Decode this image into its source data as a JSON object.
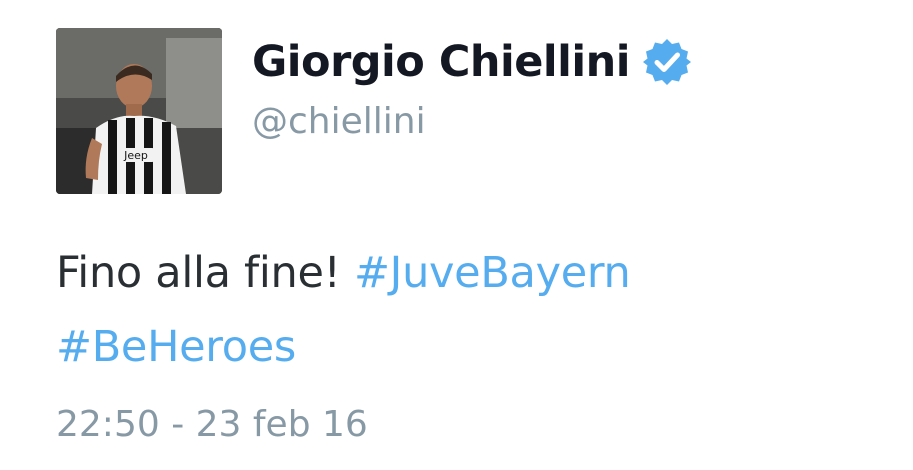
{
  "tweet": {
    "author": {
      "display_name": "Giorgio Chiellini",
      "handle": "@chiellini",
      "verified_icon": "verified-badge-icon",
      "avatar_jersey_text": "Jeep"
    },
    "text_plain": "Fino alla fine! ",
    "hashtags": [
      "#JuveBayern",
      "#BeHeroes"
    ],
    "timestamp": "22:50 - 23 feb 16"
  },
  "colors": {
    "name": "#141823",
    "handle": "#8899a6",
    "body": "#292f33",
    "hashtag": "#55acee",
    "verified": "#55acee"
  }
}
